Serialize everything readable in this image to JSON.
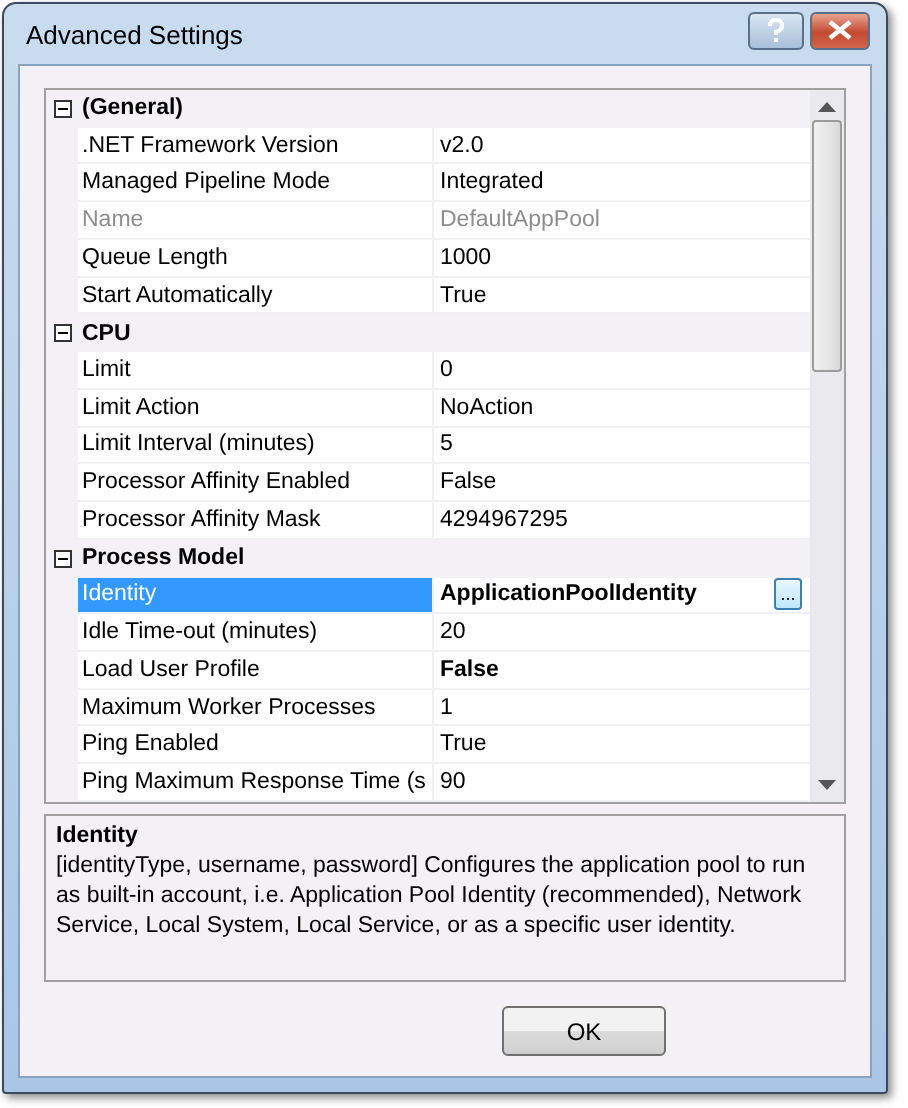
{
  "window": {
    "title": "Advanced Settings"
  },
  "grid": {
    "rows": [
      {
        "kind": "category",
        "name": "(General)",
        "expanded": true
      },
      {
        "kind": "property",
        "name": ".NET Framework Version",
        "value": "v2.0",
        "disabled": false,
        "bold": false,
        "selected": false
      },
      {
        "kind": "property",
        "name": "Managed Pipeline Mode",
        "value": "Integrated",
        "disabled": false,
        "bold": false,
        "selected": false
      },
      {
        "kind": "property",
        "name": "Name",
        "value": "DefaultAppPool",
        "disabled": true,
        "bold": false,
        "selected": false
      },
      {
        "kind": "property",
        "name": "Queue Length",
        "value": "1000",
        "disabled": false,
        "bold": false,
        "selected": false
      },
      {
        "kind": "property",
        "name": "Start Automatically",
        "value": "True",
        "disabled": false,
        "bold": false,
        "selected": false
      },
      {
        "kind": "category",
        "name": "CPU",
        "expanded": true
      },
      {
        "kind": "property",
        "name": "Limit",
        "value": "0",
        "disabled": false,
        "bold": false,
        "selected": false
      },
      {
        "kind": "property",
        "name": "Limit Action",
        "value": "NoAction",
        "disabled": false,
        "bold": false,
        "selected": false
      },
      {
        "kind": "property",
        "name": "Limit Interval (minutes)",
        "value": "5",
        "disabled": false,
        "bold": false,
        "selected": false
      },
      {
        "kind": "property",
        "name": "Processor Affinity Enabled",
        "value": "False",
        "disabled": false,
        "bold": false,
        "selected": false
      },
      {
        "kind": "property",
        "name": "Processor Affinity Mask",
        "value": "4294967295",
        "disabled": false,
        "bold": false,
        "selected": false
      },
      {
        "kind": "category",
        "name": "Process Model",
        "expanded": true
      },
      {
        "kind": "property",
        "name": "Identity",
        "value": "ApplicationPoolIdentity",
        "disabled": false,
        "bold": true,
        "selected": true,
        "ellipsis": "..."
      },
      {
        "kind": "property",
        "name": "Idle Time-out (minutes)",
        "value": "20",
        "disabled": false,
        "bold": false,
        "selected": false
      },
      {
        "kind": "property",
        "name": "Load User Profile",
        "value": "False",
        "disabled": false,
        "bold": true,
        "selected": false
      },
      {
        "kind": "property",
        "name": "Maximum Worker Processes",
        "value": "1",
        "disabled": false,
        "bold": false,
        "selected": false
      },
      {
        "kind": "property",
        "name": "Ping Enabled",
        "value": "True",
        "disabled": false,
        "bold": false,
        "selected": false
      },
      {
        "kind": "property",
        "name": "Ping Maximum Response Time (s",
        "value": "90",
        "disabled": false,
        "bold": false,
        "selected": false
      }
    ]
  },
  "description": {
    "title": "Identity",
    "text": "[identityType, username, password] Configures the application pool to run as built-in account, i.e. Application Pool Identity (recommended), Network Service, Local System, Local Service, or as a specific user identity."
  },
  "buttons": [
    "OK"
  ]
}
